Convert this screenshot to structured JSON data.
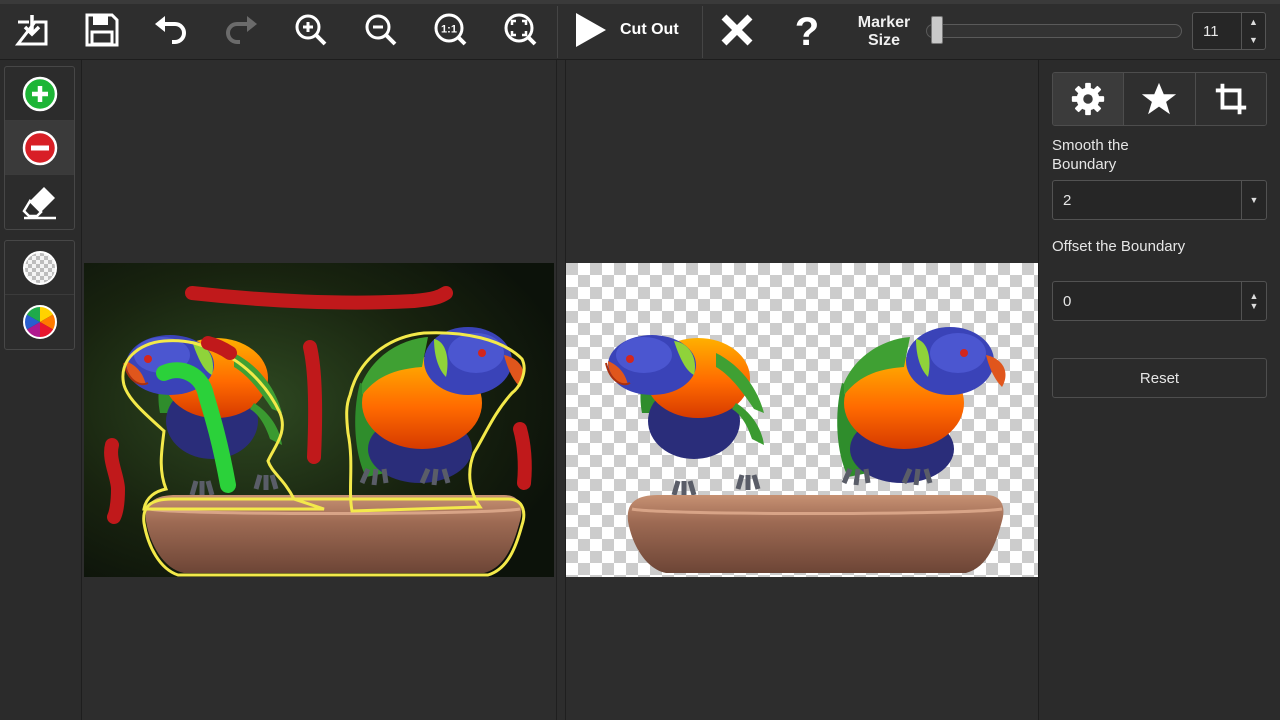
{
  "toolbar": {
    "buttons": [
      {
        "name": "open-image-button",
        "icon": "import-icon"
      },
      {
        "name": "save-button",
        "icon": "floppy-disk-icon"
      },
      {
        "name": "undo-button",
        "icon": "undo-icon"
      },
      {
        "name": "redo-button",
        "icon": "redo-icon"
      },
      {
        "name": "zoom-in-button",
        "icon": "zoom-in-icon"
      },
      {
        "name": "zoom-out-button",
        "icon": "zoom-out-icon"
      },
      {
        "name": "actual-size-button",
        "icon": "actual-size-icon"
      },
      {
        "name": "fit-screen-button",
        "icon": "fit-screen-icon"
      }
    ],
    "cut_out_label": "Cut Out",
    "close_icon": "close-icon",
    "help_icon": "help-icon",
    "marker_label_line1": "Marker",
    "marker_label_line2": "Size",
    "marker_size_value": "11",
    "marker_slider_fraction": 0.02
  },
  "left_tools": {
    "group1": [
      {
        "name": "add-marker-tool",
        "icon": "plus-circle-icon",
        "color": "#1db536"
      },
      {
        "name": "remove-marker-tool",
        "icon": "minus-circle-icon",
        "color": "#d81f26"
      },
      {
        "name": "eraser-tool",
        "icon": "eraser-icon",
        "color": "#ffffff"
      }
    ],
    "group2": [
      {
        "name": "transparent-background-tool",
        "icon": "transparency-icon"
      },
      {
        "name": "color-background-tool",
        "icon": "color-wheel-icon"
      }
    ]
  },
  "canvas": {
    "left_image": "parrots-marked",
    "right_image": "parrots-cutout"
  },
  "properties": {
    "tabs": [
      {
        "name": "tab-settings",
        "icon": "gear-icon"
      },
      {
        "name": "tab-effects",
        "icon": "star-icon"
      },
      {
        "name": "tab-crop",
        "icon": "crop-icon"
      }
    ],
    "smooth_label": "Smooth the Boundary",
    "smooth_value": "2",
    "offset_label": "Offset the Boundary",
    "offset_value": "0",
    "reset_label": "Reset"
  },
  "colors": {
    "keep_marker": "#2bd13a",
    "remove_marker": "#c0191b",
    "boundary": "#f3e94a"
  }
}
